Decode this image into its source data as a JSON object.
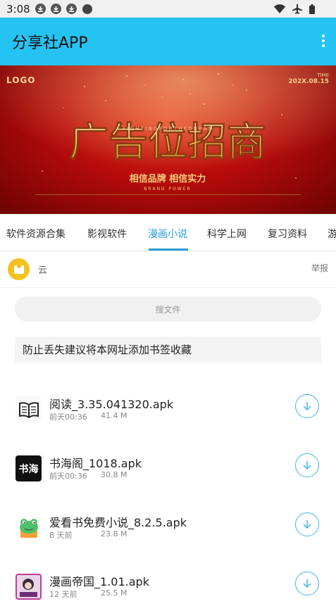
{
  "status_bar": {
    "time": "3:08"
  },
  "app_bar": {
    "title": "分享社APP"
  },
  "banner": {
    "logo": "LOGO",
    "time_label": "TIME",
    "date": "202X.08.15",
    "headline": "广告位招商",
    "slogan": "相信品牌 相信实力",
    "slogan_en": "BRAND POWER",
    "spaced_en": "F I G H T I N G   F O R   T H E   D R E A M"
  },
  "tabs": [
    {
      "label": "软件资源合集"
    },
    {
      "label": "影视软件"
    },
    {
      "label": "漫画小说",
      "active": true
    },
    {
      "label": "科学上网"
    },
    {
      "label": "复习资料"
    },
    {
      "label": "游"
    }
  ],
  "user": {
    "name": "云",
    "report": "举报"
  },
  "search": {
    "placeholder": "搜文件"
  },
  "notice": "防止丢失建议将本网址添加书签收藏",
  "files": [
    {
      "name": "阅读_3.35.041320.apk",
      "time": "前天00:36",
      "size": "41.4 M",
      "icon": "book-icon"
    },
    {
      "name": "书海阁_1018.apk",
      "time": "前天00:36",
      "size": "30.8 M",
      "icon": "shuhai-icon",
      "icon_text": "书海"
    },
    {
      "name": "爱看书免费小说_8.2.5.apk",
      "time": "8 天前",
      "size": "23.8 M",
      "icon": "frog-icon"
    },
    {
      "name": "漫画帝国_1.01.apk",
      "time": "12 天前",
      "size": "25.5 M",
      "icon": "manga-icon"
    }
  ],
  "colors": {
    "app_bar": "#25c3f2",
    "accent": "#2a9ed4",
    "avatar": "#f4c220",
    "banner_red": "#b80c0b"
  }
}
